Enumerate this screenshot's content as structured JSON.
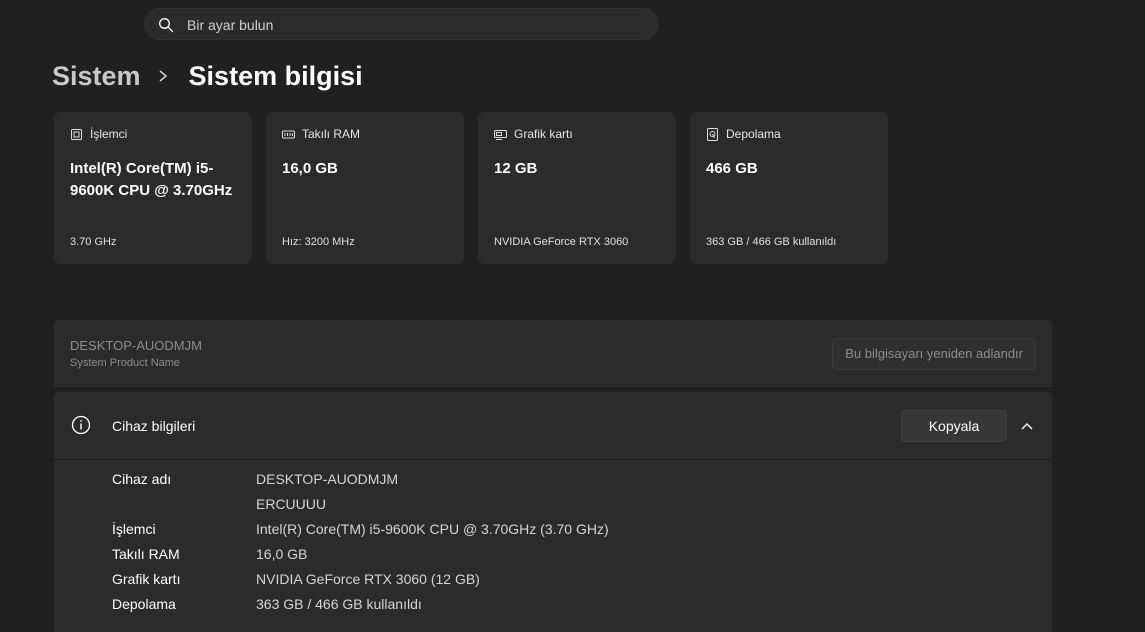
{
  "search": {
    "placeholder": "Bir ayar bulun"
  },
  "breadcrumb": {
    "parent": "Sistem",
    "current": "Sistem bilgisi"
  },
  "cards": [
    {
      "label": "İşlemci",
      "value": "Intel(R) Core(TM) i5-9600K CPU @ 3.70GHz",
      "sub": "3.70 GHz",
      "icon": "processor-icon"
    },
    {
      "label": "Takılı RAM",
      "value": "16,0 GB",
      "sub": "Hız: 3200 MHz",
      "icon": "ram-icon"
    },
    {
      "label": "Grafik kartı",
      "value": "12 GB",
      "sub": "NVIDIA GeForce RTX 3060",
      "icon": "graphics-card-icon"
    },
    {
      "label": "Depolama",
      "value": "466 GB",
      "sub": "363 GB / 466 GB kullanıldı",
      "icon": "storage-icon"
    }
  ],
  "pc": {
    "name": "DESKTOP-AUODMJM",
    "model": "System Product Name",
    "rename_label": "Bu bilgisayarı yeniden adlandır"
  },
  "device_info": {
    "title": "Cihaz bilgileri",
    "copy_label": "Kopyala",
    "rows": [
      {
        "label": "Cihaz adı",
        "value": "DESKTOP-AUODMJM"
      },
      {
        "label": "",
        "value": "ERCUUUU"
      },
      {
        "label": "İşlemci",
        "value": "Intel(R) Core(TM) i5-9600K CPU @ 3.70GHz (3.70 GHz)"
      },
      {
        "label": "Takılı RAM",
        "value": "16,0 GB"
      },
      {
        "label": "Grafik kartı",
        "value": "NVIDIA GeForce RTX 3060 (12 GB)"
      },
      {
        "label": "Depolama",
        "value": "363 GB / 466 GB kullanıldı"
      }
    ]
  },
  "colors": {
    "background": "#202020",
    "card": "#2b2b2b",
    "muted_text": "#8d8d8d"
  }
}
